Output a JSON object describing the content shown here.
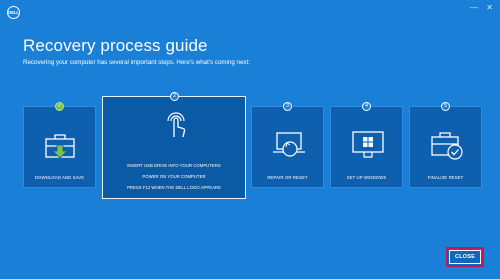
{
  "window": {
    "logo_text": "DELL",
    "minimize_glyph": "—",
    "close_glyph": "✕"
  },
  "header": {
    "title": "Recovery process guide",
    "subtitle": "Recovering your computer has several important steps. Here's what's coming next:"
  },
  "steps": [
    {
      "badge": "✓",
      "label": "DOWNLOAD AND SAVE",
      "icon": "toolbox-download-icon",
      "status": "done"
    },
    {
      "badge": "2",
      "icon": "touch-hand-icon",
      "status": "active",
      "instructions": [
        "INSERT USB DRIVE INTO YOUR COMPUTERS",
        "POWER ON YOUR COMPUTER",
        "PRESS F12 WHEN THE DELL LOGO APPEARS"
      ]
    },
    {
      "badge": "3",
      "label": "REPAIR OR RESET",
      "icon": "laptop-refresh-icon",
      "status": "pending"
    },
    {
      "badge": "4",
      "label": "SET UP WINDOWS",
      "icon": "windows-monitor-icon",
      "status": "pending"
    },
    {
      "badge": "5",
      "label": "FINALIZE RESET",
      "icon": "toolbox-check-icon",
      "status": "pending"
    }
  ],
  "footer": {
    "close_label": "CLOSE"
  },
  "colors": {
    "background": "#1a7fd6",
    "card": "#0e5fae",
    "done": "#7dc242",
    "highlight": "#c2185b"
  }
}
